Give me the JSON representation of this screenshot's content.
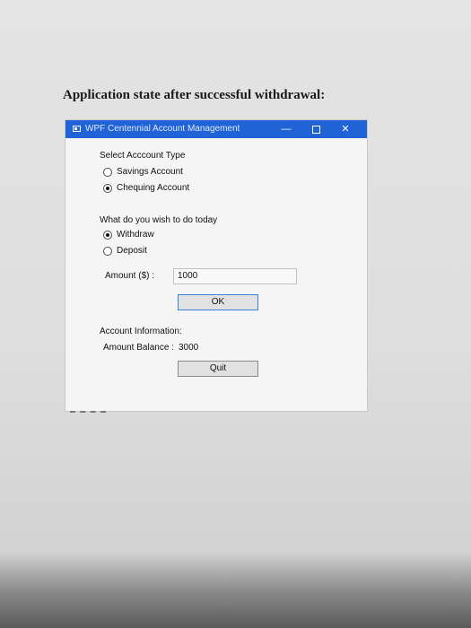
{
  "caption": "Application state after successful withdrawal:",
  "window": {
    "title": "WPF Centennial Account Management",
    "controls": {
      "minimize": "—",
      "close": "✕"
    }
  },
  "account_type": {
    "heading": "Select Acccount Type",
    "options": [
      {
        "label": "Savings Account",
        "checked": false
      },
      {
        "label": "Chequing Account",
        "checked": true
      }
    ]
  },
  "action": {
    "heading": "What do you wish to do today",
    "options": [
      {
        "label": "Withdraw",
        "checked": true
      },
      {
        "label": "Deposit",
        "checked": false
      }
    ]
  },
  "amount": {
    "label": "Amount ($) :",
    "value": "1000"
  },
  "ok_button": "OK",
  "account_info": {
    "heading": "Account Information:",
    "balance_label": "Amount Balance :",
    "balance_value": "3000"
  },
  "quit_button": "Quit"
}
